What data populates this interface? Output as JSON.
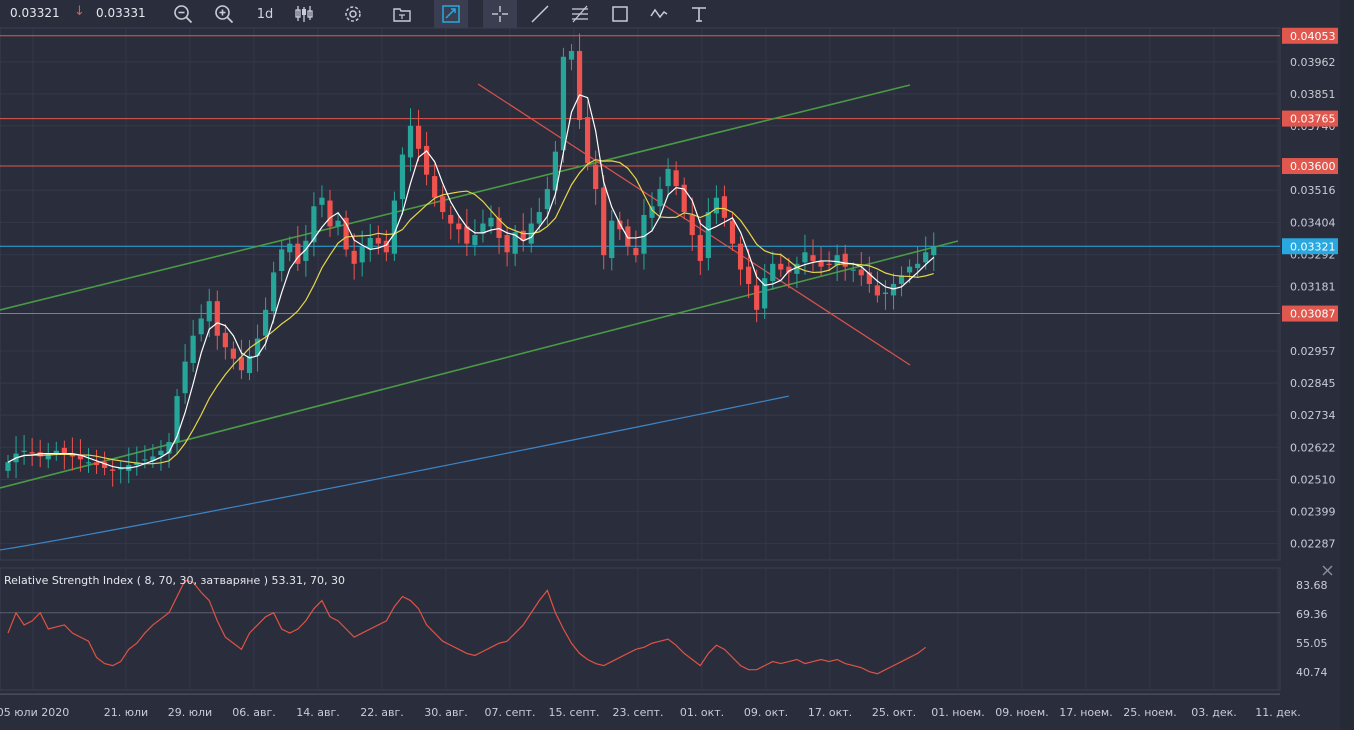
{
  "toolbar": {
    "last_price": "0.03321",
    "direction_icon": "arrow-down-icon",
    "prev_price": "0.03331",
    "timeframe": "1d",
    "tools": [
      "zoom-out-icon",
      "zoom-in-icon",
      "timeframe-selector",
      "candlestick-icon",
      "settings-icon",
      "template-icon",
      "snapshot-icon",
      "crosshair-icon",
      "trendline-icon",
      "fib-icon",
      "rectangle-icon",
      "path-icon",
      "text-icon"
    ],
    "active_tools": [
      "snapshot-icon",
      "crosshair-icon"
    ]
  },
  "colors": {
    "background": "#2a2d3c",
    "grid": "#343848",
    "up": "#26a69a",
    "down": "#ef5350",
    "ma_fast": "#ffffff",
    "ma_mid": "#e6d64a",
    "ma_slow": "#3d86c6",
    "hline": "#e0574d",
    "current_line": "#29a8e0",
    "trend_green": "#4a9a45",
    "trend_red": "#d9534f",
    "rsi": "#e05243"
  },
  "chart_data": [
    {
      "type": "candlestick",
      "x_axis_labels": [
        "05 юли 2020",
        "21. юли",
        "29. юли",
        "06. авг.",
        "14. авг.",
        "22. авг.",
        "30. авг.",
        "07. септ.",
        "15. септ.",
        "23. септ.",
        "01. окт.",
        "09. окт.",
        "17. окт.",
        "25. окт.",
        "01. ноем.",
        "09. ноем.",
        "17. ноем.",
        "25. ноем.",
        "03. дек.",
        "11. дек."
      ],
      "y_axis_ticks": [
        "0.03962",
        "0.03851",
        "0.03740",
        "0.03516",
        "0.03404",
        "0.03292",
        "0.03181",
        "0.02957",
        "0.02845",
        "0.02734",
        "0.02622",
        "0.02510",
        "0.02399",
        "0.02287"
      ],
      "y_range": [
        0.0223,
        0.0408
      ],
      "horizontal_levels": [
        {
          "label": "0.04053",
          "value": 0.04053
        },
        {
          "label": "0.03765",
          "value": 0.03765
        },
        {
          "label": "0.03600",
          "value": 0.036
        },
        {
          "label": "0.03087",
          "value": 0.03087
        }
      ],
      "current_price": {
        "label": "0.03321",
        "value": 0.03321
      },
      "candles_close": [
        0.0257,
        0.026,
        0.0261,
        0.026,
        0.0259,
        0.026,
        0.0261,
        0.026,
        0.0259,
        0.0258,
        0.0257,
        0.0256,
        0.0255,
        0.0254,
        0.0255,
        0.0256,
        0.0257,
        0.0258,
        0.0259,
        0.0261,
        0.0264,
        0.028,
        0.0292,
        0.0301,
        0.0307,
        0.0313,
        0.0301,
        0.0297,
        0.0293,
        0.0289,
        0.0294,
        0.03,
        0.031,
        0.0323,
        0.0331,
        0.0333,
        0.0326,
        0.0334,
        0.0346,
        0.0349,
        0.0339,
        0.0341,
        0.0331,
        0.0326,
        0.0332,
        0.0335,
        0.0333,
        0.033,
        0.0348,
        0.0364,
        0.0374,
        0.0366,
        0.0357,
        0.0349,
        0.0344,
        0.034,
        0.0338,
        0.0333,
        0.0336,
        0.034,
        0.0342,
        0.0335,
        0.033,
        0.0337,
        0.0334,
        0.034,
        0.0344,
        0.0352,
        0.0365,
        0.0398,
        0.04,
        0.0376,
        0.0361,
        0.0352,
        0.0329,
        0.0341,
        0.0338,
        0.0332,
        0.0329,
        0.0343,
        0.0346,
        0.0352,
        0.0359,
        0.0353,
        0.0344,
        0.0336,
        0.0327,
        0.0344,
        0.0349,
        0.0342,
        0.0333,
        0.0324,
        0.0319,
        0.031,
        0.0321,
        0.0326,
        0.0324,
        0.0323,
        0.0326,
        0.033,
        0.0327,
        0.0325,
        0.0326,
        0.0329,
        0.0325,
        0.0324,
        0.0322,
        0.0319,
        0.0315,
        0.0316,
        0.0319,
        0.0322,
        0.0325,
        0.0326,
        0.033,
        0.0332
      ],
      "moving_averages": [
        "ma_fast",
        "ma_mid",
        "ma_slow"
      ]
    },
    {
      "type": "line",
      "title": "Relative Strength Index ( 8, 70, 30, затваряне ) 53.31, 70, 30",
      "y_axis_ticks": [
        "83.68",
        "69.36",
        "55.05",
        "40.74"
      ],
      "y_range": [
        32,
        92
      ],
      "levels": [
        70,
        30
      ],
      "values": [
        60,
        70,
        64,
        66,
        70,
        62,
        63,
        64,
        60,
        58,
        56,
        48,
        45,
        44,
        46,
        52,
        55,
        60,
        64,
        67,
        70,
        78,
        86,
        85,
        80,
        76,
        66,
        58,
        55,
        52,
        60,
        64,
        68,
        70,
        62,
        60,
        62,
        66,
        72,
        76,
        68,
        66,
        62,
        58,
        60,
        62,
        64,
        66,
        73,
        78,
        76,
        72,
        64,
        60,
        56,
        54,
        52,
        50,
        49,
        51,
        53,
        55,
        56,
        60,
        64,
        70,
        76,
        81,
        70,
        62,
        55,
        50,
        47,
        45,
        44,
        46,
        48,
        50,
        52,
        53,
        55,
        56,
        57,
        54,
        50,
        47,
        44,
        50,
        54,
        52,
        48,
        44,
        42,
        42,
        44,
        46,
        45,
        46,
        47,
        45,
        46,
        47,
        46,
        47,
        45,
        44,
        43,
        41,
        40,
        42,
        44,
        46,
        48,
        50,
        53
      ]
    }
  ]
}
